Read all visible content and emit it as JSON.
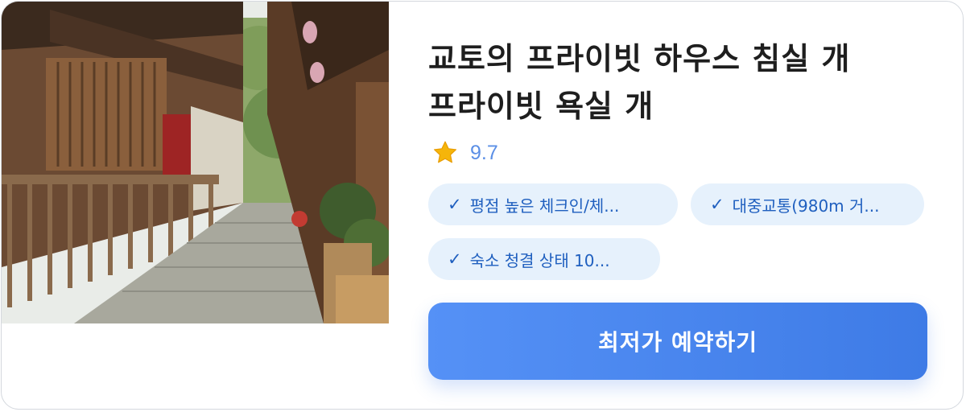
{
  "listing": {
    "title_line1": "교토의 프라이빗 하우스 침실 개",
    "title_line2": "프라이빗 욕실 개",
    "rating": "9.7",
    "highlights": [
      {
        "check": "✓",
        "label": "평점 높은 체크인/체..."
      },
      {
        "check": "✓",
        "label": "대중교통(980m 거..."
      },
      {
        "check": "✓",
        "label": "숙소 청결 상태 10..."
      }
    ],
    "cta_label": "최저가 예약하기"
  },
  "colors": {
    "accent": "#4A86EE",
    "chip_bg": "#E6F1FC",
    "chip_text": "#1F5FBF",
    "rating_text": "#5B8FE6",
    "star": "#F5B50A"
  },
  "icons": {
    "rating": "star-icon",
    "highlight": "check-mark"
  }
}
